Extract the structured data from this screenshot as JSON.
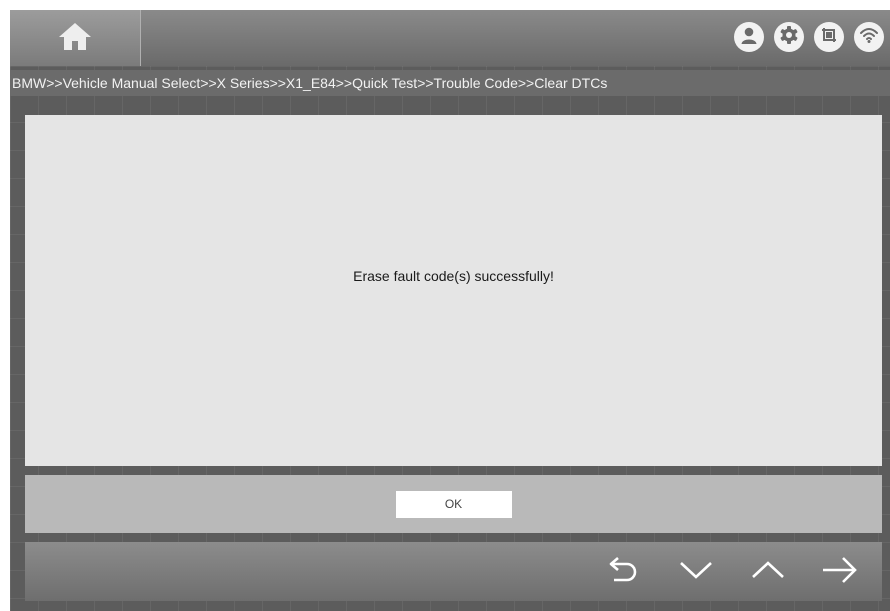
{
  "topbar": {
    "home_icon": "home-icon",
    "status_icons": [
      "user-icon",
      "gear-icon",
      "screenshot-icon",
      "wifi-icon"
    ]
  },
  "breadcrumb": "BMW>>Vehicle Manual Select>>X Series>>X1_E84>>Quick Test>>Trouble Code>>Clear DTCs",
  "dialog": {
    "message": "Erase fault code(s) successfully!",
    "ok_label": "OK"
  },
  "navbar": {
    "icons": [
      "back-icon",
      "chevron-down-icon",
      "chevron-up-icon",
      "arrow-right-icon"
    ]
  },
  "colors": {
    "background": "#5c5c5c",
    "content_panel": "#e5e5e5",
    "button_bar": "#b9b9b9",
    "breadcrumb_text": "#f2f2f2"
  }
}
